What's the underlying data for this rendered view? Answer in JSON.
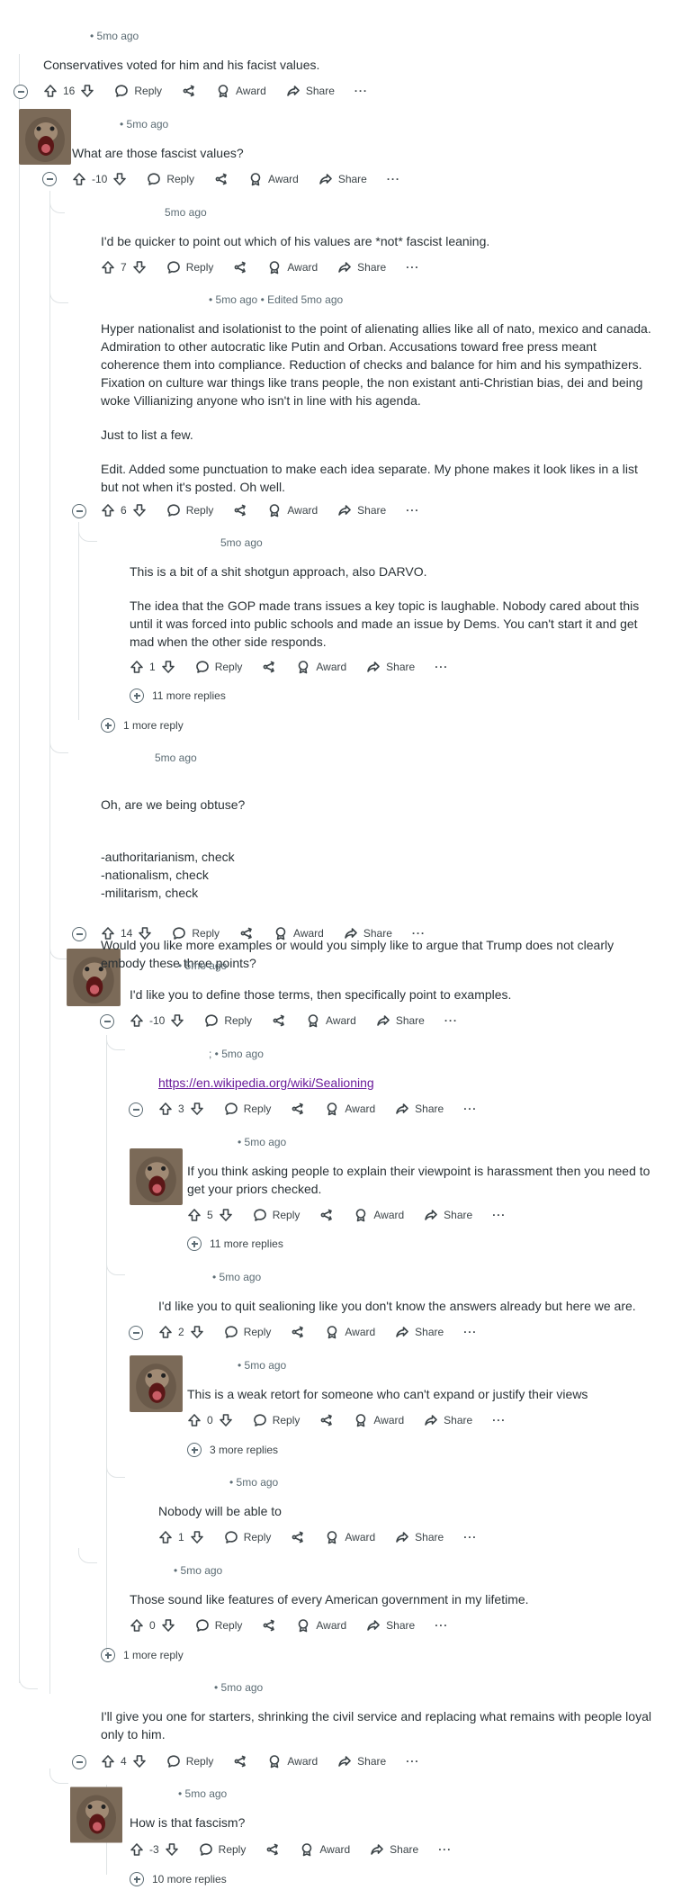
{
  "labels": {
    "reply": "Reply",
    "award": "Award",
    "share": "Share",
    "more_dots": "···"
  },
  "comments": [
    {
      "meta": "• 5mo ago",
      "body": [
        "Conservatives voted for him and his facist values."
      ],
      "score": "16"
    },
    {
      "meta": "• 5mo ago",
      "body": [
        "What are those fascist values?"
      ],
      "score": "-10"
    },
    {
      "meta": "5mo ago",
      "body": [
        "I'd be quicker to point out which of his values are *not* fascist leaning."
      ],
      "score": "7"
    },
    {
      "meta": "• 5mo ago • Edited 5mo ago",
      "body": [
        "Hyper nationalist and isolationist to the point of alienating allies like all of nato, mexico and canada. Admiration to other autocratic like Putin and Orban. Accusations toward free press meant coherence them into compliance. Reduction of checks and balance for him and his sympathizers. Fixation on culture war things like trans people, the non existant anti-Christian bias, dei and being woke Villianizing anyone who isn't in line with his agenda.",
        "Just to list a few.",
        "Edit. Added some punctuation to make each idea separate. My phone makes it look likes in a list but not when it's posted. Oh well."
      ],
      "score": "6"
    },
    {
      "meta": "5mo ago",
      "body": [
        "This is a bit of a shit shotgun approach, also DARVO.",
        "The idea that the GOP made trans issues a key topic is laughable. Nobody cared about this until it was forced into public schools and made an issue by Dems. You can't start it and get mad when the other side responds."
      ],
      "score": "1"
    },
    {
      "meta": "5mo ago",
      "body": [
        "Oh, are we being obtuse?",
        "-authoritarianism, check\n-nationalism, check\n-militarism, check",
        "Would you like more examples or would you simply like to argue that Trump does not clearly embody these three points?"
      ],
      "score": "14"
    },
    {
      "meta": "• 5mo ago",
      "body": [
        "I'd like you to define those terms, then specifically point to examples."
      ],
      "score": "-10"
    },
    {
      "meta": "; • 5mo ago",
      "link": "https://en.wikipedia.org/wiki/Sealioning",
      "score": "3"
    },
    {
      "meta": "• 5mo ago",
      "body": [
        "If you think asking people to explain their viewpoint is harassment then you need to get your priors checked."
      ],
      "score": "5"
    },
    {
      "meta": "• 5mo ago",
      "body": [
        "I'd like you to quit sealioning like you don't know the answers already but here we are."
      ],
      "score": "2"
    },
    {
      "meta": "• 5mo ago",
      "body": [
        "This is a weak retort for someone who can't expand or justify their views"
      ],
      "score": "0"
    },
    {
      "meta": "• 5mo ago",
      "body": [
        "Nobody will be able to"
      ],
      "score": "1"
    },
    {
      "meta": "• 5mo ago",
      "body": [
        "Those sound like features of every American government in my lifetime."
      ],
      "score": "0"
    },
    {
      "meta": "• 5mo ago",
      "body": [
        "I'll give you one for starters, shrinking the civil service and replacing what remains with people loyal only to him."
      ],
      "score": "4"
    },
    {
      "meta": "• 5mo ago",
      "body": [
        "How is that fascism?"
      ],
      "score": "-3"
    }
  ],
  "more_replies": [
    {
      "label": "11 more replies"
    },
    {
      "label": "1 more reply"
    },
    {
      "label": "11 more replies"
    },
    {
      "label": "3 more replies"
    },
    {
      "label": "1 more reply"
    },
    {
      "label": "10 more replies"
    }
  ]
}
